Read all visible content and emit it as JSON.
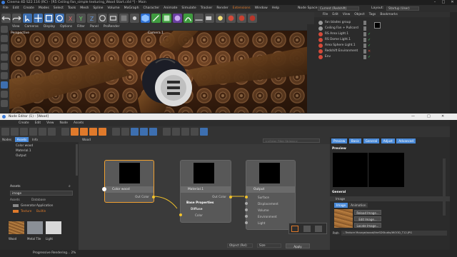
{
  "window": {
    "title": "Cinema 4D S22.116 (RC) - [R5 Ceiling Fan_simple texturing_Wood Start.c4d *] - Main",
    "menus": [
      "File",
      "Edit",
      "Create",
      "Modes",
      "Select",
      "Tools",
      "Mesh",
      "Spline",
      "Volume",
      "MoGraph",
      "Character",
      "Animate",
      "Simulate",
      "Tracker",
      "Render",
      "Extensions",
      "Window",
      "Help"
    ],
    "node_space_label": "Node Space:",
    "node_space_value": "Current (Redshift)",
    "layout_label": "Layout:",
    "layout_value": "Startup (User)"
  },
  "viewport": {
    "menus": [
      "View",
      "Cameras",
      "Display",
      "Options",
      "Filter",
      "Panel",
      "ProRender"
    ],
    "perspective_label": "Perspective",
    "camera_label": "Camera.1"
  },
  "object_manager": {
    "menus": [
      "File",
      "Edit",
      "View",
      "Object",
      "Tags",
      "Bookmarks"
    ],
    "items": [
      {
        "name": "fan blades group",
        "color": "#9a9a9a"
      },
      {
        "name": "Ceiling Fan + Pullcord",
        "color": "#9a9a9a"
      },
      {
        "name": "RS Area Light.1",
        "color": "#d44a3a"
      },
      {
        "name": "RS Dome Light.1",
        "color": "#d44a3a"
      },
      {
        "name": "Area Sphere Light.1",
        "color": "#d44a3a"
      },
      {
        "name": "Redshift Environment",
        "color": "#d44a3a"
      },
      {
        "name": "Env",
        "color": "#d44a3a"
      }
    ]
  },
  "node_editor": {
    "title": "Node Editor (1) - [Wood]",
    "menus": [
      "Create",
      "Edit",
      "View",
      "Node",
      "Assets"
    ],
    "left_tabs": [
      "Nodes",
      "Assets",
      "Info"
    ],
    "tree_items": [
      "Color wood",
      "Material.1",
      "Output"
    ],
    "assets_label": "Assets",
    "search_value": "image",
    "col_assets": "Assets",
    "col_database": "Database",
    "asset_rows": [
      {
        "name": "Generator",
        "db": "Application"
      },
      {
        "name": "Texture",
        "db": "Builtin"
      }
    ],
    "canvas_tab": "Wood",
    "filter_placeholder": "<<Enter Filter String>>",
    "nodes": {
      "color_wood": {
        "title": "Color wood",
        "out": "Out Color"
      },
      "material": {
        "title": "Material.1",
        "out": "Out Color",
        "section": "Base Properties",
        "sub": "Diffuse",
        "port": "Color"
      },
      "output": {
        "title": "Output",
        "ports": [
          "Surface",
          "Displacement",
          "Volume",
          "Environment",
          "Light"
        ]
      }
    },
    "swatch_labels": [
      "Wood",
      "Metal Tile",
      "Light"
    ],
    "status_text": "Progressive Rendering... 2%"
  },
  "attributes": {
    "tabs": [
      "Preview",
      "Basic",
      "General",
      "Adjust",
      "Advanced"
    ],
    "preview_label": "Preview",
    "general_label": "General",
    "image_label": "Image",
    "image_tabs": [
      "Image",
      "Animation"
    ],
    "buttons": [
      "Reload Image...",
      "Edit Image...",
      "Locate Image..."
    ],
    "path_label": "Path",
    "path_value": "...Texture Mourge/wood/theSDStudio/WOOD_T12.JPG",
    "object_label": "Object (Rel)",
    "size_label": "Size",
    "apply_label": "Apply"
  },
  "colors": {
    "accent_orange": "#e07a2b",
    "active_blue": "#4a8ad8",
    "port_yellow": "#f2c22b",
    "selection_orange": "#f0a030"
  }
}
